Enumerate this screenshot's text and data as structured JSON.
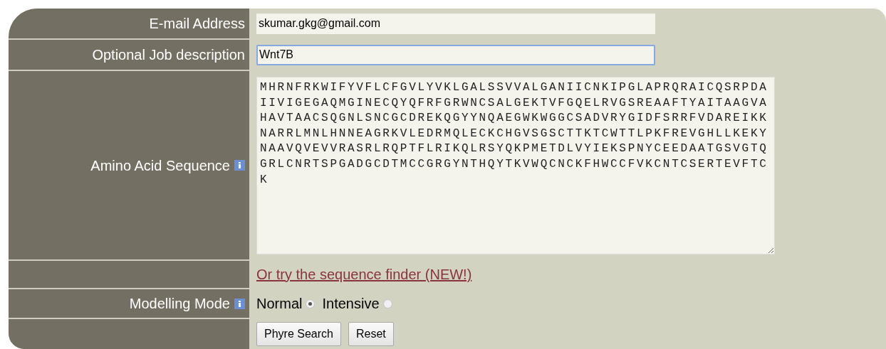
{
  "rows": [
    {
      "kind": "text",
      "label": "E-mail Address",
      "info": false,
      "value": "skumar.gkg@gmail.com",
      "focused": false
    },
    {
      "kind": "text",
      "label": "Optional Job description",
      "info": false,
      "value": "Wnt7B",
      "focused": true
    },
    {
      "kind": "textarea",
      "label": "Amino Acid Sequence",
      "info": true,
      "value": "MHRNFRKWIFYVFLCFGVLYVKLGALSSVVALGANIICNKIPGLAPRQRAICQSRPDAIIVIGEGAQMGINECQYQFRFGRWNCSALGEKTVFGQELRVGSREAAFTYAITAAGVAHAVTAACSQGNLSNCGCDREKQGYYNQAEGWKWGGCSADVRYGIDFSRRFVDAREIKKNARRLMNLHNNEAGRKVLEDRMQLECKCHGVSGSCTTKTCWTTLPKFREVGHLLKEKYNAAVQVEVVRASRLRQPTFLRIKQLRSYQKPMETDLVYIEKSPNYCEEDAATGSVGTQGRLCNRTSPGADGCDTMCCGRGYNTHQYTKVWQCNCKFHWCCFVKCNTCSERTEVFTCK"
    },
    {
      "kind": "link",
      "text": "Or try the sequence finder (NEW!)"
    },
    {
      "kind": "radio",
      "label": "Modelling Mode",
      "info": true,
      "options": [
        {
          "label": "Normal",
          "selected": true
        },
        {
          "label": "Intensive",
          "selected": false
        }
      ]
    },
    {
      "kind": "buttons",
      "buttons": [
        "Phyre Search",
        "Reset"
      ]
    }
  ]
}
